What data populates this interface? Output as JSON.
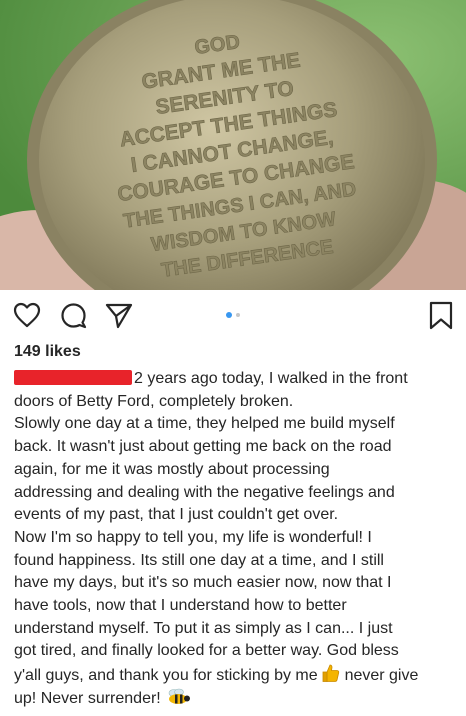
{
  "post": {
    "image": {
      "coin_inscription": [
        "GOD",
        "GRANT ME THE",
        "SERENITY TO",
        "ACCEPT THE THINGS",
        "I CANNOT CHANGE,",
        "COURAGE TO CHANGE",
        "THE THINGS I CAN, AND",
        "WISDOM TO KNOW",
        "THE DIFFERENCE"
      ]
    },
    "actions": {
      "like_icon": "heart-icon",
      "comment_icon": "comment-icon",
      "share_icon": "paper-plane-icon",
      "save_icon": "bookmark-icon"
    },
    "carousel": {
      "count": 2,
      "active": 1,
      "active_color": "#3897f0",
      "inactive_color": "#c7c7c7"
    },
    "likes": "149 likes",
    "caption": {
      "lines": [
        "2 years ago today, I walked in the front",
        "doors of Betty Ford, completely broken.",
        "Slowly one day at a time, they helped me build myself",
        "back. It wasn't just about getting me back on the road",
        "again, for me it was mostly about processing",
        "addressing and dealing with the negative feelings and",
        "events of my past, that I just couldn't get over.",
        "Now I'm so happy to tell you, my life is wonderful! I",
        "found happiness. Its still one day at a time, and I still",
        "have my days, but it's so much easier now, now that I",
        "have tools, now that I understand how to better",
        "understand myself. To put it as simply as I can... I just",
        "got tired, and finally looked for a better way. God bless",
        "y'all guys, and thank you for sticking by me",
        "never give",
        "up! Never surrender!"
      ],
      "redaction_color": "#e8232a",
      "emoji_1": "thumbs-up-icon",
      "emoji_2": "bee-icon"
    }
  }
}
